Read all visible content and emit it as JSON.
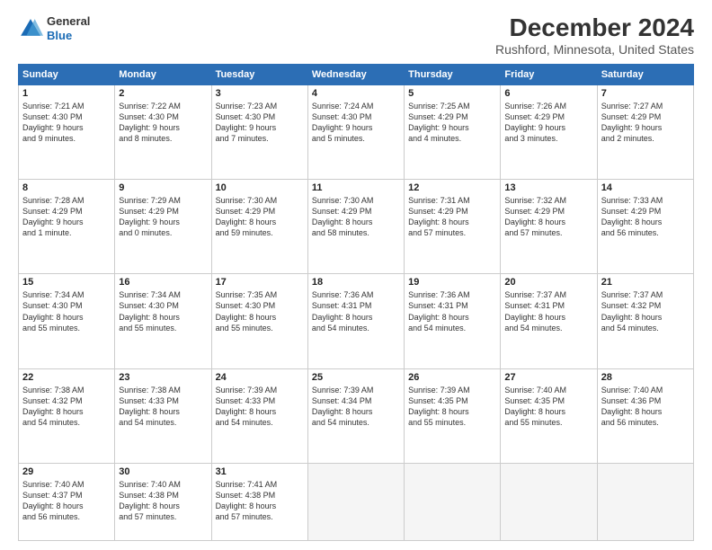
{
  "logo": {
    "line1": "General",
    "line2": "Blue"
  },
  "title": "December 2024",
  "subtitle": "Rushford, Minnesota, United States",
  "headers": [
    "Sunday",
    "Monday",
    "Tuesday",
    "Wednesday",
    "Thursday",
    "Friday",
    "Saturday"
  ],
  "weeks": [
    [
      {
        "day": "1",
        "info": "Sunrise: 7:21 AM\nSunset: 4:30 PM\nDaylight: 9 hours\nand 9 minutes."
      },
      {
        "day": "2",
        "info": "Sunrise: 7:22 AM\nSunset: 4:30 PM\nDaylight: 9 hours\nand 8 minutes."
      },
      {
        "day": "3",
        "info": "Sunrise: 7:23 AM\nSunset: 4:30 PM\nDaylight: 9 hours\nand 7 minutes."
      },
      {
        "day": "4",
        "info": "Sunrise: 7:24 AM\nSunset: 4:30 PM\nDaylight: 9 hours\nand 5 minutes."
      },
      {
        "day": "5",
        "info": "Sunrise: 7:25 AM\nSunset: 4:29 PM\nDaylight: 9 hours\nand 4 minutes."
      },
      {
        "day": "6",
        "info": "Sunrise: 7:26 AM\nSunset: 4:29 PM\nDaylight: 9 hours\nand 3 minutes."
      },
      {
        "day": "7",
        "info": "Sunrise: 7:27 AM\nSunset: 4:29 PM\nDaylight: 9 hours\nand 2 minutes."
      }
    ],
    [
      {
        "day": "8",
        "info": "Sunrise: 7:28 AM\nSunset: 4:29 PM\nDaylight: 9 hours\nand 1 minute."
      },
      {
        "day": "9",
        "info": "Sunrise: 7:29 AM\nSunset: 4:29 PM\nDaylight: 9 hours\nand 0 minutes."
      },
      {
        "day": "10",
        "info": "Sunrise: 7:30 AM\nSunset: 4:29 PM\nDaylight: 8 hours\nand 59 minutes."
      },
      {
        "day": "11",
        "info": "Sunrise: 7:30 AM\nSunset: 4:29 PM\nDaylight: 8 hours\nand 58 minutes."
      },
      {
        "day": "12",
        "info": "Sunrise: 7:31 AM\nSunset: 4:29 PM\nDaylight: 8 hours\nand 57 minutes."
      },
      {
        "day": "13",
        "info": "Sunrise: 7:32 AM\nSunset: 4:29 PM\nDaylight: 8 hours\nand 57 minutes."
      },
      {
        "day": "14",
        "info": "Sunrise: 7:33 AM\nSunset: 4:29 PM\nDaylight: 8 hours\nand 56 minutes."
      }
    ],
    [
      {
        "day": "15",
        "info": "Sunrise: 7:34 AM\nSunset: 4:30 PM\nDaylight: 8 hours\nand 55 minutes."
      },
      {
        "day": "16",
        "info": "Sunrise: 7:34 AM\nSunset: 4:30 PM\nDaylight: 8 hours\nand 55 minutes."
      },
      {
        "day": "17",
        "info": "Sunrise: 7:35 AM\nSunset: 4:30 PM\nDaylight: 8 hours\nand 55 minutes."
      },
      {
        "day": "18",
        "info": "Sunrise: 7:36 AM\nSunset: 4:31 PM\nDaylight: 8 hours\nand 54 minutes."
      },
      {
        "day": "19",
        "info": "Sunrise: 7:36 AM\nSunset: 4:31 PM\nDaylight: 8 hours\nand 54 minutes."
      },
      {
        "day": "20",
        "info": "Sunrise: 7:37 AM\nSunset: 4:31 PM\nDaylight: 8 hours\nand 54 minutes."
      },
      {
        "day": "21",
        "info": "Sunrise: 7:37 AM\nSunset: 4:32 PM\nDaylight: 8 hours\nand 54 minutes."
      }
    ],
    [
      {
        "day": "22",
        "info": "Sunrise: 7:38 AM\nSunset: 4:32 PM\nDaylight: 8 hours\nand 54 minutes."
      },
      {
        "day": "23",
        "info": "Sunrise: 7:38 AM\nSunset: 4:33 PM\nDaylight: 8 hours\nand 54 minutes."
      },
      {
        "day": "24",
        "info": "Sunrise: 7:39 AM\nSunset: 4:33 PM\nDaylight: 8 hours\nand 54 minutes."
      },
      {
        "day": "25",
        "info": "Sunrise: 7:39 AM\nSunset: 4:34 PM\nDaylight: 8 hours\nand 54 minutes."
      },
      {
        "day": "26",
        "info": "Sunrise: 7:39 AM\nSunset: 4:35 PM\nDaylight: 8 hours\nand 55 minutes."
      },
      {
        "day": "27",
        "info": "Sunrise: 7:40 AM\nSunset: 4:35 PM\nDaylight: 8 hours\nand 55 minutes."
      },
      {
        "day": "28",
        "info": "Sunrise: 7:40 AM\nSunset: 4:36 PM\nDaylight: 8 hours\nand 56 minutes."
      }
    ],
    [
      {
        "day": "29",
        "info": "Sunrise: 7:40 AM\nSunset: 4:37 PM\nDaylight: 8 hours\nand 56 minutes."
      },
      {
        "day": "30",
        "info": "Sunrise: 7:40 AM\nSunset: 4:38 PM\nDaylight: 8 hours\nand 57 minutes."
      },
      {
        "day": "31",
        "info": "Sunrise: 7:41 AM\nSunset: 4:38 PM\nDaylight: 8 hours\nand 57 minutes."
      },
      {
        "day": "",
        "info": ""
      },
      {
        "day": "",
        "info": ""
      },
      {
        "day": "",
        "info": ""
      },
      {
        "day": "",
        "info": ""
      }
    ]
  ]
}
